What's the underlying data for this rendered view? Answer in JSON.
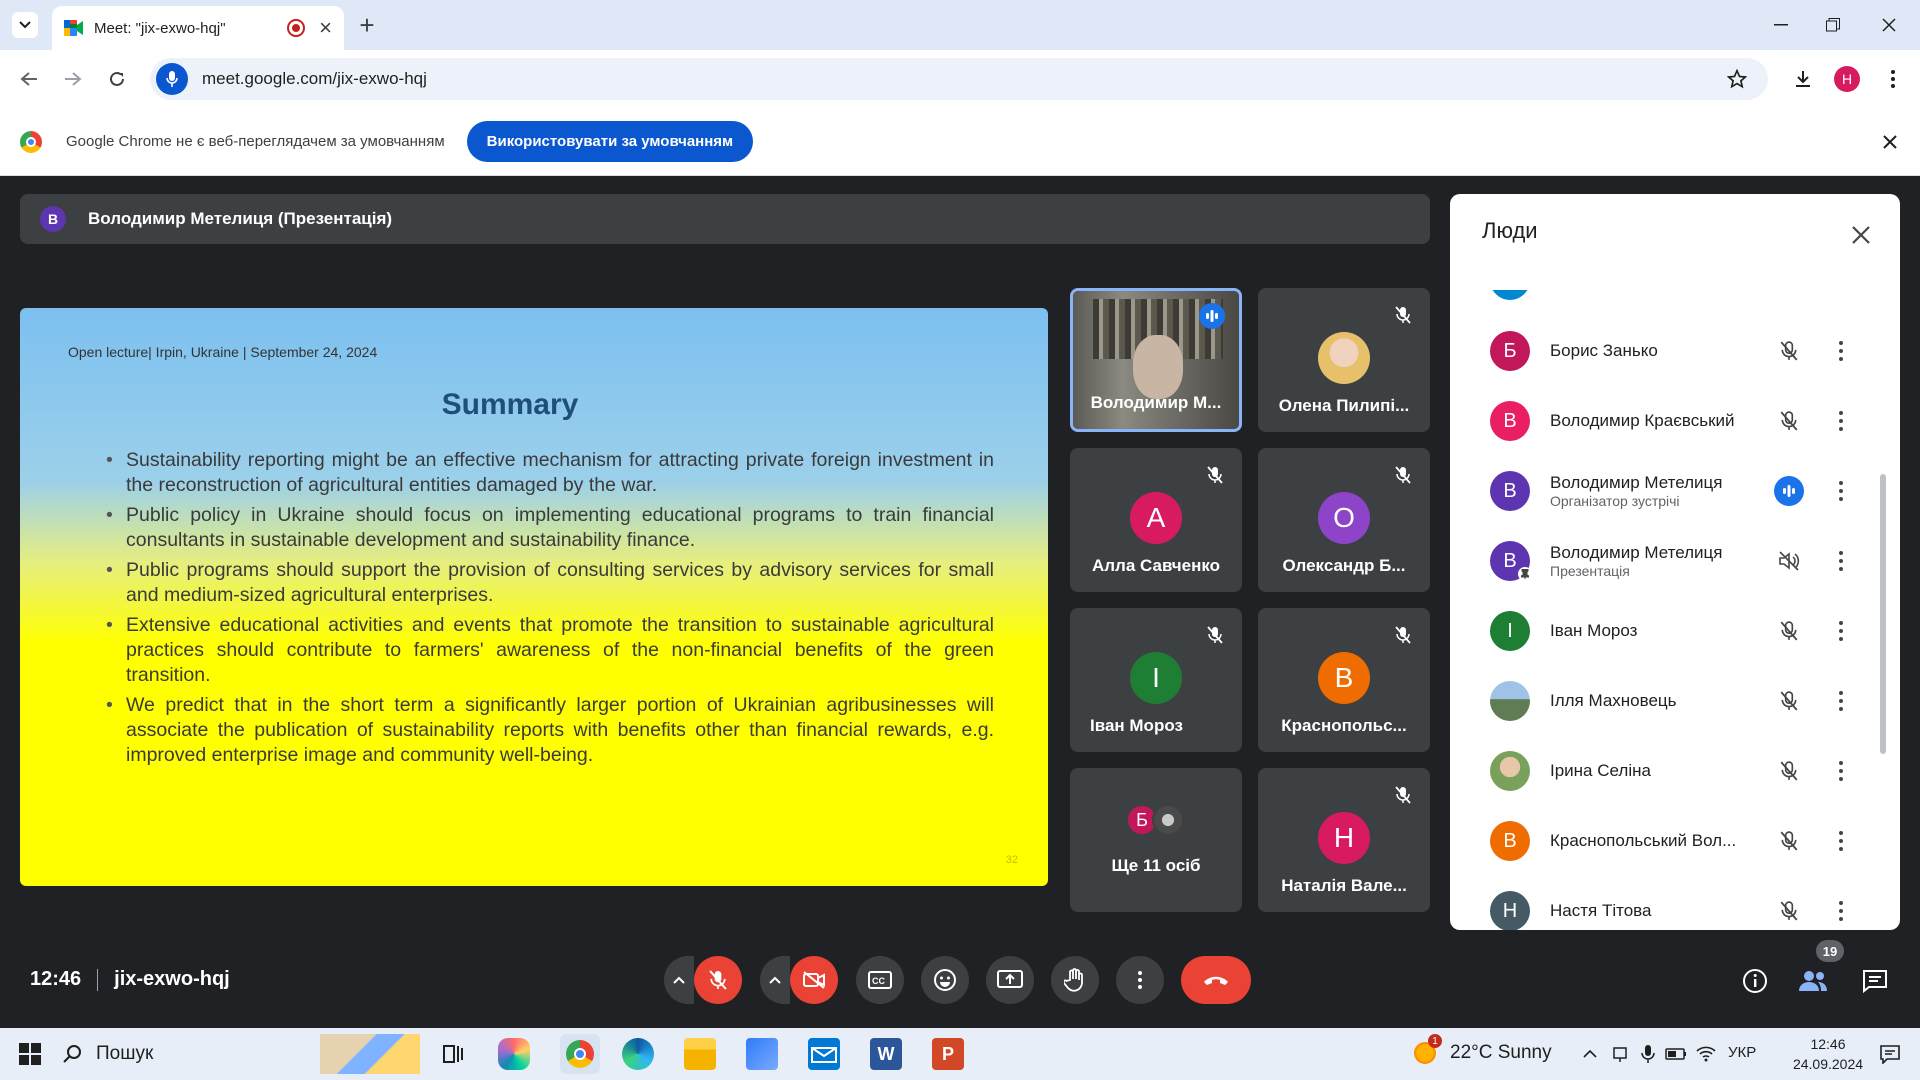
{
  "browser": {
    "tab_title": "Meet: \"jix-exwo-hqj\"",
    "url": "meet.google.com/jix-exwo-hqj",
    "profile_initial": "Н",
    "infobar_text": "Google Chrome не є веб-переглядачем за умовчанням",
    "infobar_button": "Використовувати за умовчанням"
  },
  "meet": {
    "presenter_initial": "В",
    "presenter_label": "Володимир Метелиця (Презентація)",
    "time": "12:46",
    "meeting_code": "jix-exwo-hqj",
    "people_count": "19",
    "colors": {
      "bg": "#202124",
      "tile": "#3c4043",
      "accent": "#8ab4f8",
      "leave": "#ea4335"
    }
  },
  "slide": {
    "header": "Open lecture| Irpin, Ukraine | September 24, 2024",
    "title": "Summary",
    "bullets": [
      "Sustainability reporting might be an effective mechanism for attracting private foreign investment in the reconstruction of agricultural entities damaged by the war.",
      "Public policy in Ukraine should focus on implementing educational programs to train financial consultants in sustainable development and sustainability finance.",
      "Public programs should support the provision of consulting services by advisory services for small and medium-sized agricultural enterprises.",
      "Extensive educational activities and events that promote the transition to sustainable agricultural practices should contribute to farmers' awareness of the non-financial benefits of the green transition.",
      "We predict that in the short term a significantly larger portion of Ukrainian agribusinesses will associate the publication of sustainability reports with benefits other than financial rewards, e.g. improved enterprise image and community well-being."
    ],
    "page_number": "32"
  },
  "tiles": [
    {
      "name": "Володимир М...",
      "initial": "",
      "color": "",
      "speaking": true
    },
    {
      "name": "Олена Пилипі...",
      "initial": "",
      "color": "",
      "speaking": false
    },
    {
      "name": "Алла Савченко",
      "initial": "А",
      "color": "#d81b60",
      "speaking": false
    },
    {
      "name": "Олександр Б...",
      "initial": "О",
      "color": "#8e44c9",
      "speaking": false
    },
    {
      "name": "Іван Мороз",
      "initial": "І",
      "color": "#1e7e34",
      "speaking": false
    },
    {
      "name": "Краснопольс...",
      "initial": "В",
      "color": "#ef6c00",
      "speaking": false
    },
    {
      "name": "Ще 11 осіб",
      "initial": "Б",
      "color": "#c2185b",
      "speaking": false
    },
    {
      "name": "Наталія Вале...",
      "initial": "Н",
      "color": "#d81b60",
      "speaking": false
    }
  ],
  "people_panel": {
    "title": "Люди",
    "people": [
      {
        "name": "Борис Занько",
        "sub": "",
        "initial": "Б",
        "color": "#c2185b",
        "state": "muted"
      },
      {
        "name": "Володимир Краєвський",
        "sub": "",
        "initial": "В",
        "color": "#e91e63",
        "state": "muted"
      },
      {
        "name": "Володимир Метелиця",
        "sub": "Організатор зустрічі",
        "initial": "В",
        "color": "#5e35b1",
        "state": "speaking"
      },
      {
        "name": "Володимир Метелиця",
        "sub": "Презентація",
        "initial": "В",
        "color": "#5e35b1",
        "state": "presenting"
      },
      {
        "name": "Іван Мороз",
        "sub": "",
        "initial": "І",
        "color": "#1e7e34",
        "state": "muted"
      },
      {
        "name": "Ілля Махновець",
        "sub": "",
        "initial": "",
        "color": "#6b8fb3",
        "state": "muted"
      },
      {
        "name": "Ірина Селіна",
        "sub": "",
        "initial": "",
        "color": "#a5784f",
        "state": "muted"
      },
      {
        "name": "Краснопольський Вол...",
        "sub": "",
        "initial": "В",
        "color": "#ef6c00",
        "state": "muted"
      },
      {
        "name": "Настя Тітова",
        "sub": "",
        "initial": "Н",
        "color": "#455a64",
        "state": "muted"
      }
    ]
  },
  "taskbar": {
    "search_label": "Пошук",
    "weather": "22°C  Sunny",
    "lang": "УКР",
    "time": "12:46",
    "date": "24.09.2024",
    "notif_count": "1"
  }
}
